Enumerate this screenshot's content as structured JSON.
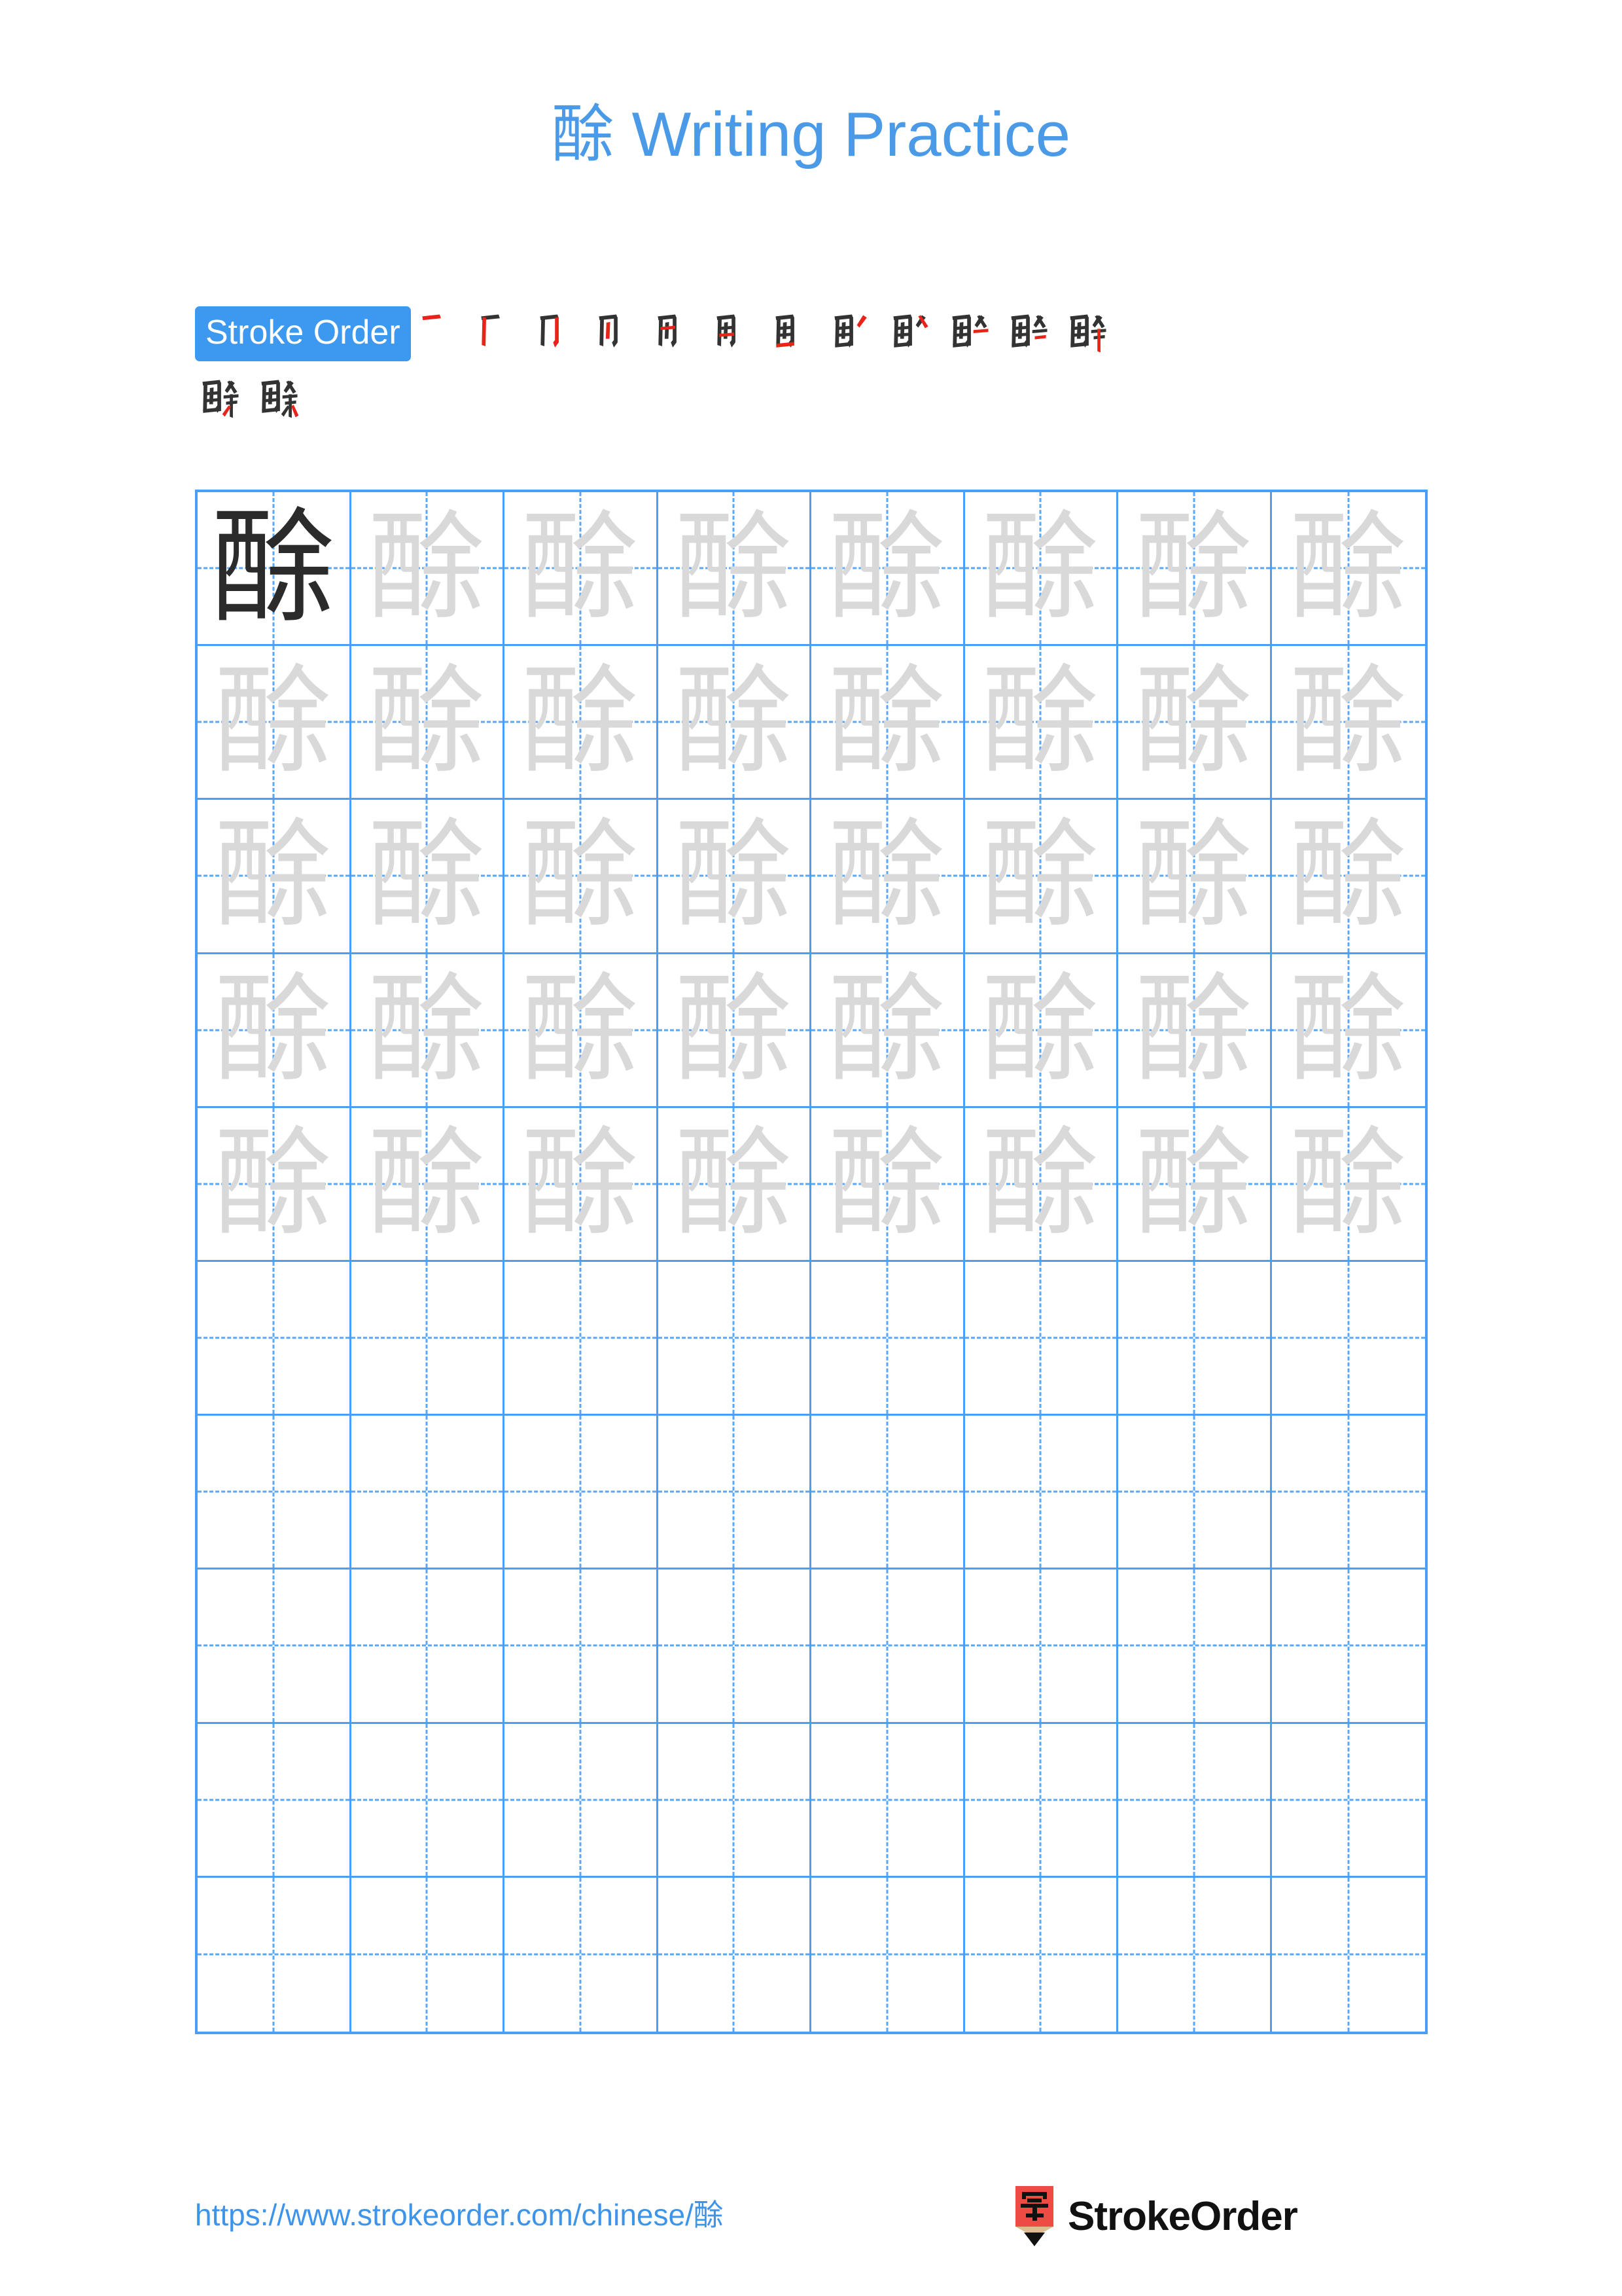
{
  "character": "酴",
  "title": {
    "character": "酴",
    "suffix": " Writing Practice",
    "full": "酴 Writing Practice",
    "color": "#4a9ae8"
  },
  "stroke_order": {
    "label": "Stroke Order",
    "badge_bg": "#3d98f0",
    "badge_text_color": "#ffffff",
    "total_strokes": 14,
    "done_stroke_color": "#333333",
    "new_stroke_color": "#e8241a",
    "steps_row1": [
      "一",
      "厂",
      "厉",
      "丙",
      "丙",
      "丙",
      "酉",
      "酉",
      "酉",
      "酉",
      "酉",
      "酴"
    ],
    "steps_row2": [
      "酴",
      "酴"
    ],
    "step_count_row1": 12,
    "step_count_row2": 2
  },
  "grid": {
    "columns": 8,
    "rows": 10,
    "filled_rows": 5,
    "model_cell": {
      "row": 1,
      "column": 1
    },
    "border_color": "#4a9ef5",
    "guide_color": "#5aa7f7",
    "trace_char_color": "#d9d9d9",
    "model_char_color": "#2b2b2b",
    "cells": [
      [
        "酴",
        "酴",
        "酴",
        "酴",
        "酴",
        "酴",
        "酴",
        "酴"
      ],
      [
        "酴",
        "酴",
        "酴",
        "酴",
        "酴",
        "酴",
        "酴",
        "酴"
      ],
      [
        "酴",
        "酴",
        "酴",
        "酴",
        "酴",
        "酴",
        "酴",
        "酴"
      ],
      [
        "酴",
        "酴",
        "酴",
        "酴",
        "酴",
        "酴",
        "酴",
        "酴"
      ],
      [
        "酴",
        "酴",
        "酴",
        "酴",
        "酴",
        "酴",
        "酴",
        "酴"
      ],
      [
        "",
        "",
        "",
        "",
        "",
        "",
        "",
        ""
      ],
      [
        "",
        "",
        "",
        "",
        "",
        "",
        "",
        ""
      ],
      [
        "",
        "",
        "",
        "",
        "",
        "",
        "",
        ""
      ],
      [
        "",
        "",
        "",
        "",
        "",
        "",
        "",
        ""
      ],
      [
        "",
        "",
        "",
        "",
        "",
        "",
        "",
        ""
      ]
    ]
  },
  "footer": {
    "url": "https://www.strokeorder.com/chinese/酴",
    "url_color": "#3d94e8",
    "brand_name": "StrokeOrder",
    "brand_icon_char": "字",
    "brand_icon_color": "#ee4b45",
    "brand_icon_wood_color": "#e0bb8f"
  }
}
